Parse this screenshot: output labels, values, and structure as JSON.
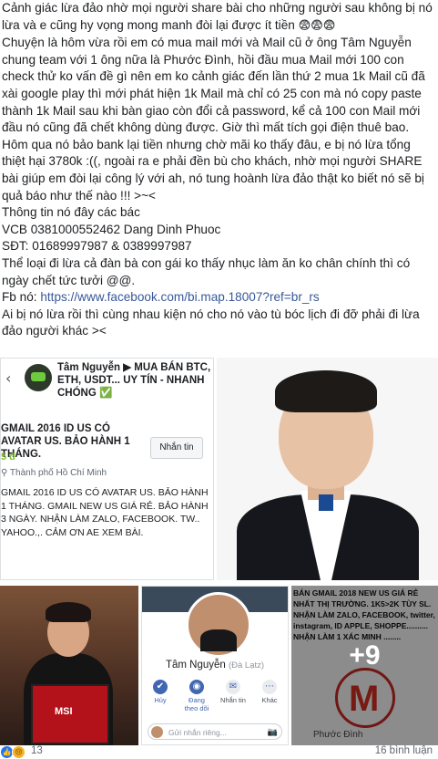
{
  "post": {
    "paragraphs": [
      {
        "text": "Cảnh giác lừa đảo nhờ mọi người share bài cho những người sau không bị nó lừa và e cũng hy vọng mong manh đòi lại được ít tiền ",
        "emoji": "😨😨😨"
      },
      {
        "text": "Chuyện là hôm vừa rồi em có mua mail mới và Mail cũ ở ông Tâm Nguyễn chung team với 1 ông nữa là Phước Đình, hồi đầu mua Mail mới 100 con check thử ko vấn đề gì nên em ko cảnh giác đến lần thứ 2 mua 1k Mail cũ đã xài google play thì mới phát hiện 1k Mail mà chỉ có 25 con mà nó copy paste thành 1k Mail sau khi bàn giao còn đổi cả password, kể cả 100 con Mail mới đầu nó cũng đã chết không dùng được. Giờ thì mất tích gọi điện thuê bao. Hôm qua nó bảo bank lại tiền nhưng chờ mãi ko thấy đâu, e bị nó lừa tổng thiệt hại 3780k :((, ngoài ra e phải đền bù cho khách, nhờ mọi người SHARE bài giúp em đòi lại công lý với ah, nó tung hoành lừa đảo thật ko biết nó sẽ bị quả báo như thế nào !!! >~<"
      },
      {
        "text": "Thông tin nó đây các bác"
      },
      {
        "text": "VCB 0381000552462 Dang Dinh Phuoc"
      },
      {
        "text": "SĐT: 01689997987 & 0389997987"
      },
      {
        "text": "Thể loại đi lừa cả đàn bà con gái ko thấy nhục làm ăn ko chân chính thì có ngày chết tức tưởi @@."
      }
    ],
    "fb_label": "Fb nó: ",
    "fb_link": "https://www.facebook.com/bi.map.18007?ref=br_rs",
    "closing": "Ai bị nó lừa rồi thì cùng nhau kiện nó cho nó vào tù bóc lịch đi đỡ phải đi lừa đảo người khác ><"
  },
  "photo1": {
    "back_icon": "‹",
    "header_name": "Tâm Nguyễn ▶ MUA BÁN BTC, ETH, USDT... UY TÍN - NHANH CHÓNG ✅",
    "listing_title": "GMAIL 2016 ID US CÓ AVATAR US. BẢO HÀNH 1 THÁNG.",
    "message_button": "Nhắn tin",
    "price": "5 đ",
    "location": "Thành phố Hồ Chí Minh",
    "description": "GMAIL 2016 ID US CÓ AVATAR US. BẢO HÀNH 1 THÁNG. GMAIL NEW US GIÁ RẺ. BẢO HÀNH 3 NGÀY. NHẬN LÀM ZALO, FACEBOOK. TW.. YAHOO.,. CẢM ƠN AE XEM BÀI."
  },
  "photo4": {
    "name": "Tâm Nguyễn",
    "name_sub": "(Đà Lạtz)",
    "actions": [
      {
        "label": "Hủy",
        "icon": "person-check-icon",
        "glyph": "✔"
      },
      {
        "label": "Đang theo dõi",
        "icon": "rss-icon",
        "glyph": "◉"
      },
      {
        "label": "Nhắn tin",
        "icon": "messenger-icon",
        "glyph": "✉"
      },
      {
        "label": "Khác",
        "icon": "more-icon",
        "glyph": "⋯"
      }
    ],
    "composer_placeholder": "Gửi nhắn riêng...",
    "camera_icon": "📷"
  },
  "photo5": {
    "ad_text": "BÁN GMAIL 2018 NEW US GIÁ RẺ NHẤT THỊ TRƯỜNG. 1K5>2K TÙY SL. NHẬN LÀM ZALO, FACEBOOK, twitter, instagram, ID APPLE, SHOPPE.......... NHẬN LÀM 1 XÁC MINH ........",
    "footer_name": "Phước Đình",
    "more_count": "+9"
  },
  "footer": {
    "reaction_count": "13",
    "comments": "16 bình luận"
  },
  "colors": {
    "link": "#385898",
    "like_blue": "#2078f4",
    "messenger_blue": "#4267b2"
  }
}
